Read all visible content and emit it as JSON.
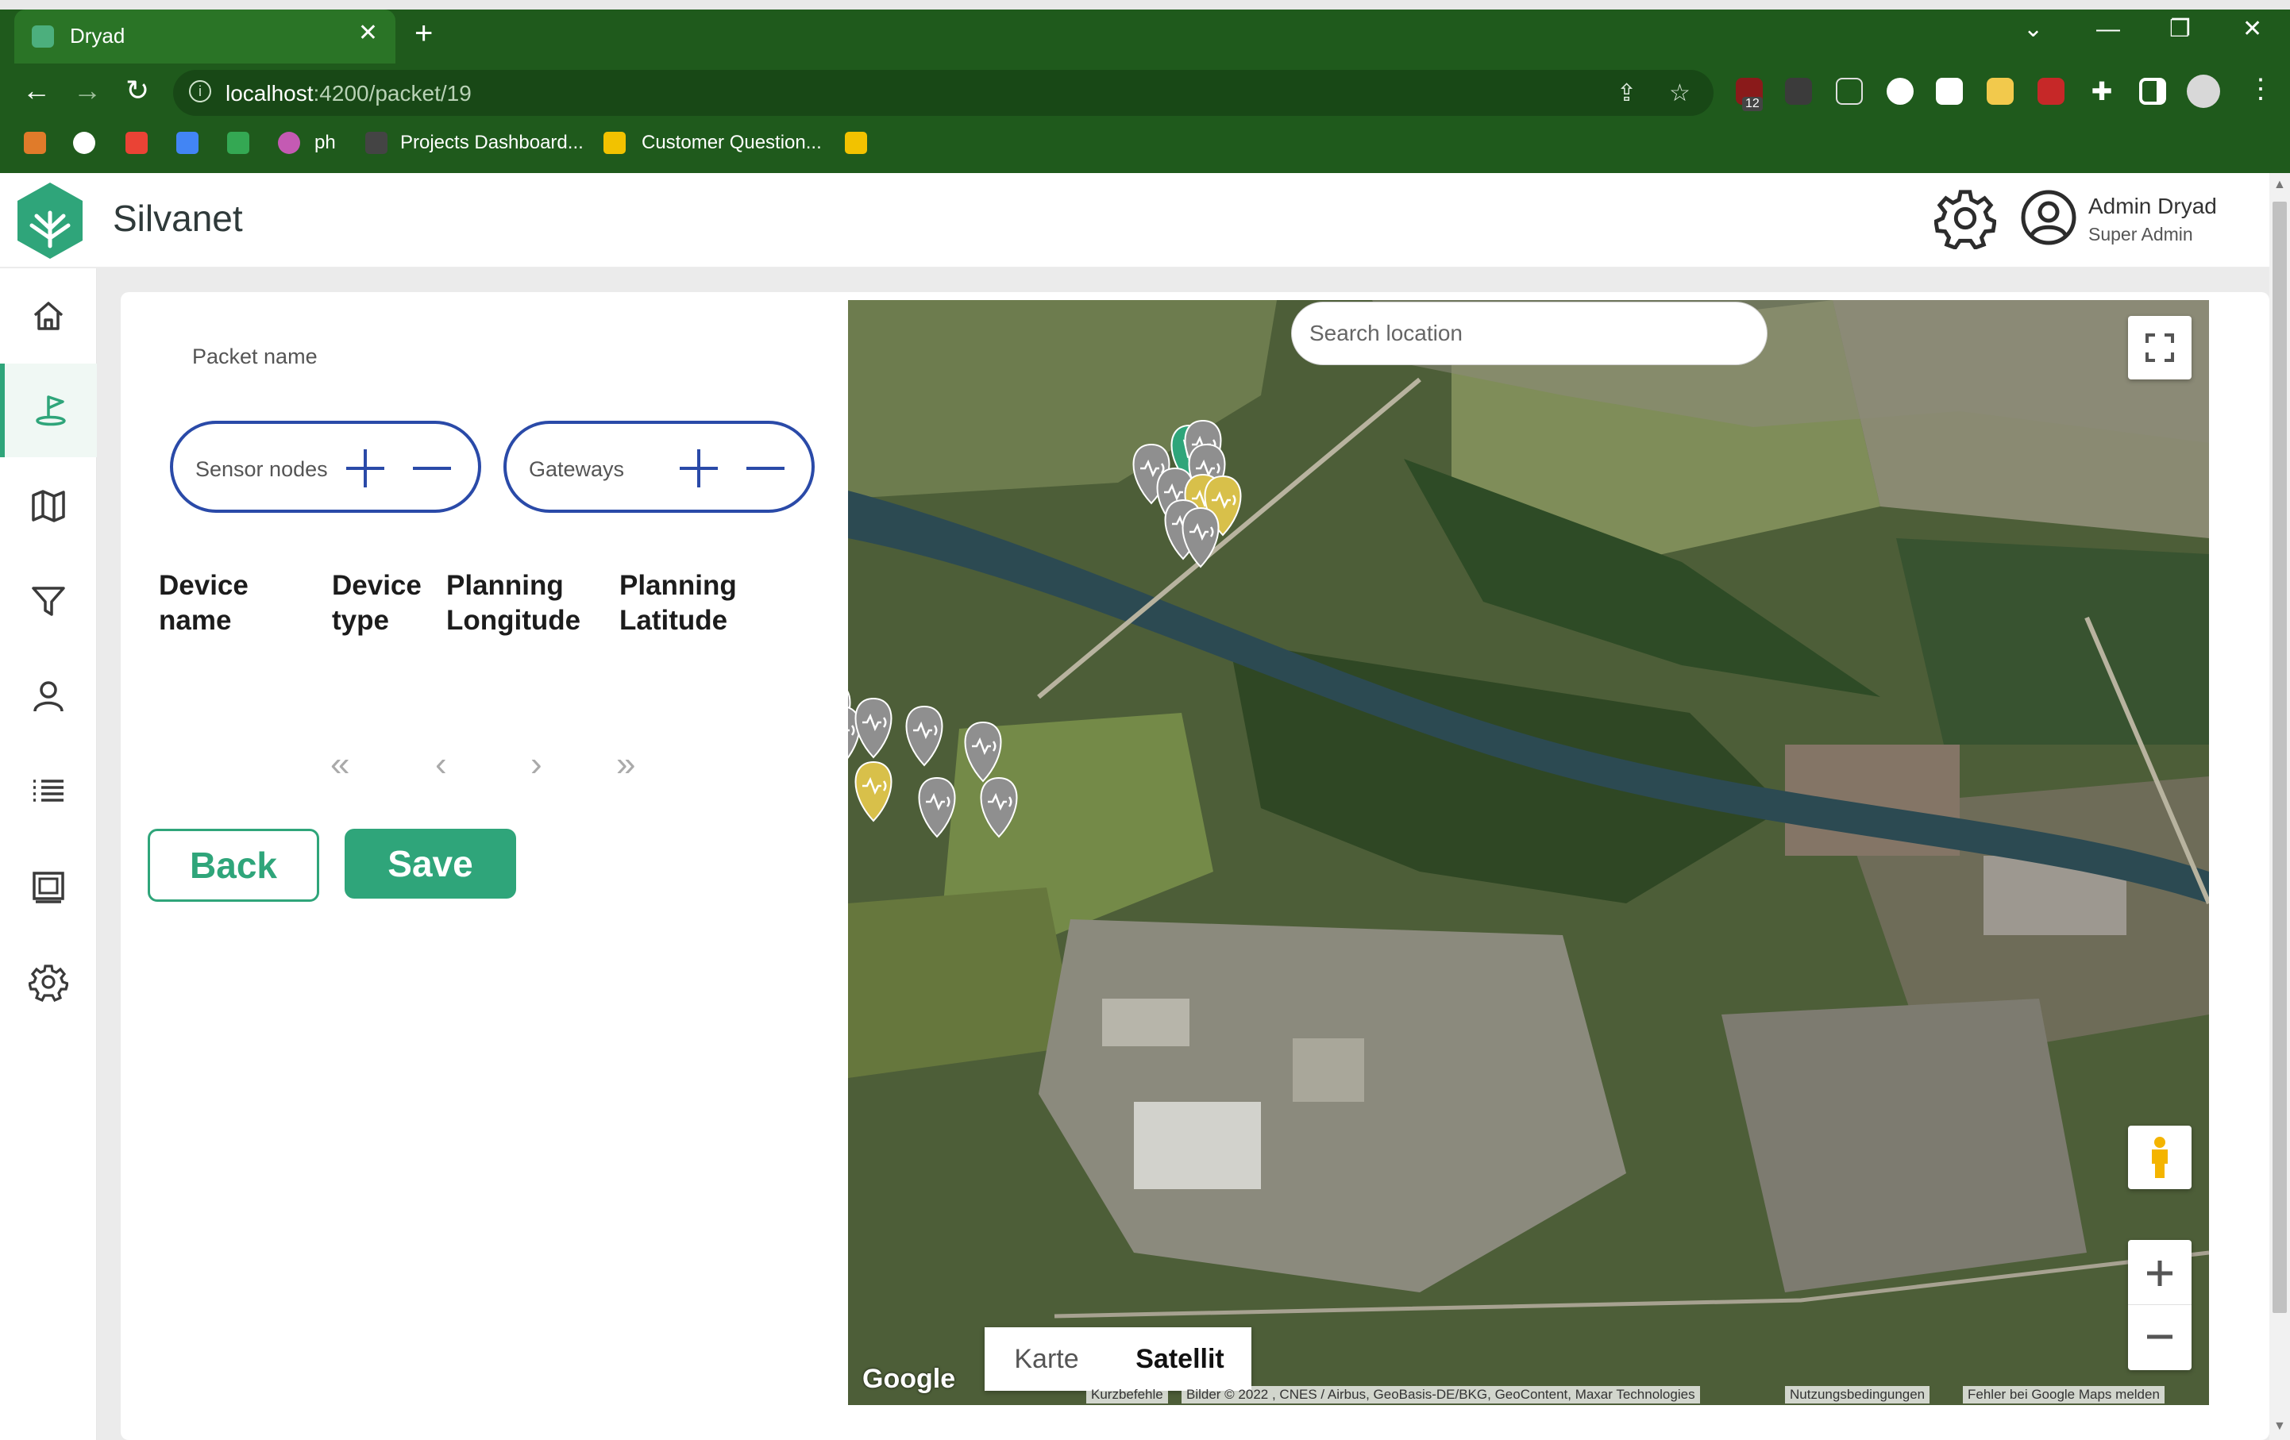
{
  "browser": {
    "tab_title": "Dryad",
    "url_host": "localhost",
    "url_path": ":4200/packet/19",
    "bookmarks": [
      {
        "label": "ph"
      },
      {
        "label": "Projects Dashboard..."
      },
      {
        "label": "Customer Question..."
      }
    ],
    "extension_badge": "12"
  },
  "header": {
    "app_name": "Silvanet",
    "user_name": "Admin Dryad",
    "user_role": "Super Admin"
  },
  "sidebar": {
    "items": [
      {
        "name": "home",
        "active": false
      },
      {
        "name": "deployment",
        "active": true
      },
      {
        "name": "map",
        "active": false
      },
      {
        "name": "filter",
        "active": false
      },
      {
        "name": "users",
        "active": false
      },
      {
        "name": "list",
        "active": false
      },
      {
        "name": "gallery",
        "active": false
      },
      {
        "name": "settings",
        "active": false
      }
    ]
  },
  "packet": {
    "name_placeholder": "Packet name",
    "sensor_nodes_label": "Sensor nodes",
    "gateways_label": "Gateways",
    "columns": [
      {
        "line1": "Device",
        "line2": "name"
      },
      {
        "line1": "Device",
        "line2": "type"
      },
      {
        "line1": "Planning",
        "line2": "Longitude"
      },
      {
        "line1": "Planning",
        "line2": "Latitude"
      }
    ],
    "pager": {
      "first": "«",
      "prev": "‹",
      "next": "›",
      "last": "»"
    },
    "back_label": "Back",
    "save_label": "Save"
  },
  "map": {
    "search_placeholder": "Search location",
    "type_map": "Karte",
    "type_satellite": "Satellit",
    "selected_type": "Satellit",
    "google_logo": "Google",
    "attribution": {
      "shortcuts": "Kurzbefehle",
      "imagery": "Bilder © 2022 , CNES / Airbus, GeoBasis-DE/BKG, GeoContent, Maxar Technologies",
      "terms": "Nutzungsbedingungen",
      "report": "Fehler bei Google Maps melden"
    },
    "marker_colors": {
      "sensor": "#8f8f8f",
      "sensor_highlight": "#d8c04a",
      "gateway": "#2fa57a"
    }
  },
  "colors": {
    "brand": "#2fa57a",
    "chrome": "#1f5a1c",
    "pill_border": "#2a4aa8"
  }
}
